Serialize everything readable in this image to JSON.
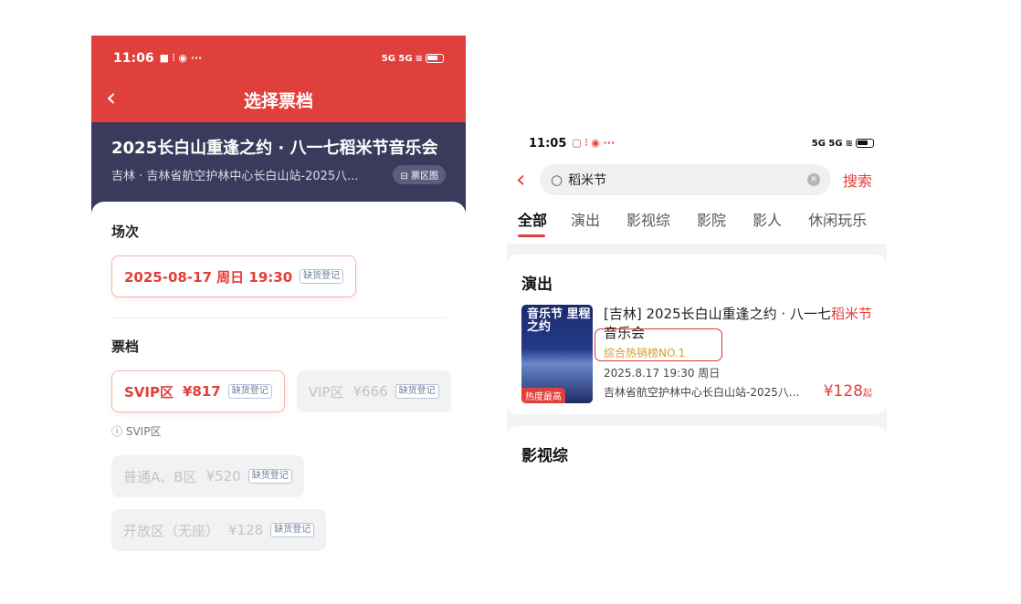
{
  "screen1": {
    "status": {
      "time": "11:06",
      "left_glyphs": "■ ⫶ ◉ ···",
      "right_glyphs": "5G 5G"
    },
    "nav": {
      "back": "‹",
      "title": "选择票档"
    },
    "event": {
      "name": "2025长白山重逢之约 · 八一七稻米节音乐会",
      "venue": "吉林 · 吉林省航空护林中心长白山站-2025八...",
      "map_label": "票区图"
    },
    "session": {
      "heading": "场次",
      "option": "2025-08-17 周日 19:30",
      "tag": "缺货登记"
    },
    "tiers": {
      "heading": "票档",
      "items": [
        {
          "label": "SVIP区",
          "price": "¥817",
          "tag": "缺货登记"
        },
        {
          "label": "VIP区",
          "price": "¥666",
          "tag": "缺货登记"
        },
        {
          "label": "普通A、B区",
          "price": "¥520",
          "tag": "缺货登记"
        },
        {
          "label": "开放区（无座）",
          "price": "¥128",
          "tag": "缺货登记"
        }
      ],
      "note": "SVIP区"
    }
  },
  "screen2": {
    "status": {
      "time": "11:05",
      "left_glyphs": "▢ ⫶ ◉ ···",
      "right_glyphs": "5G 5G"
    },
    "search": {
      "query": "稻米节",
      "button": "搜索"
    },
    "tabs": [
      "全部",
      "演出",
      "影视综",
      "影院",
      "影人",
      "休闲玩乐"
    ],
    "section1": {
      "title": "演出",
      "poster_text": "音乐节 里程之约",
      "hot_badge": "热度最高",
      "name_pre": "[吉林] 2025长白山重逢之约 · 八一七",
      "name_hl1": "稻米",
      "name_hl2": "节",
      "name_post": "音乐会",
      "rank": "综合热销榜NO.1",
      "date": "2025.8.17 19:30 周日",
      "venue": "吉林省航空护林中心长白山站-2025八...",
      "price": "¥128",
      "price_suffix": "起"
    },
    "section2": {
      "title": "影视综"
    }
  }
}
